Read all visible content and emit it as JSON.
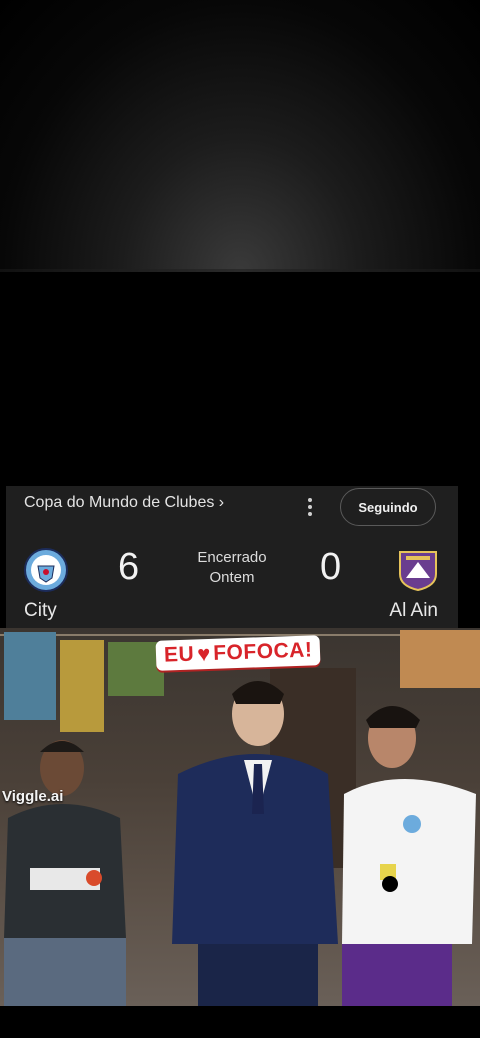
{
  "scorecard": {
    "league": "Copa do Mundo de Clubes ›",
    "follow_label": "Seguindo",
    "home": {
      "name": "City",
      "score": "6",
      "logo_icon": "manchester-city-crest-icon"
    },
    "away": {
      "name": "Al Ain",
      "score": "0",
      "logo_icon": "al-ain-crest-icon"
    },
    "status_line1": "Encerrado",
    "status_line2": "Ontem"
  },
  "meme": {
    "banner_left": "EU",
    "banner_heart": "♥",
    "banner_right": "FOFOCA!",
    "watermark": "Viggle.ai"
  },
  "colors": {
    "card_bg": "#1f1f1f",
    "banner_red": "#d8242a",
    "city_blue": "#6cabdd",
    "alain_purple": "#6a3d8f"
  }
}
